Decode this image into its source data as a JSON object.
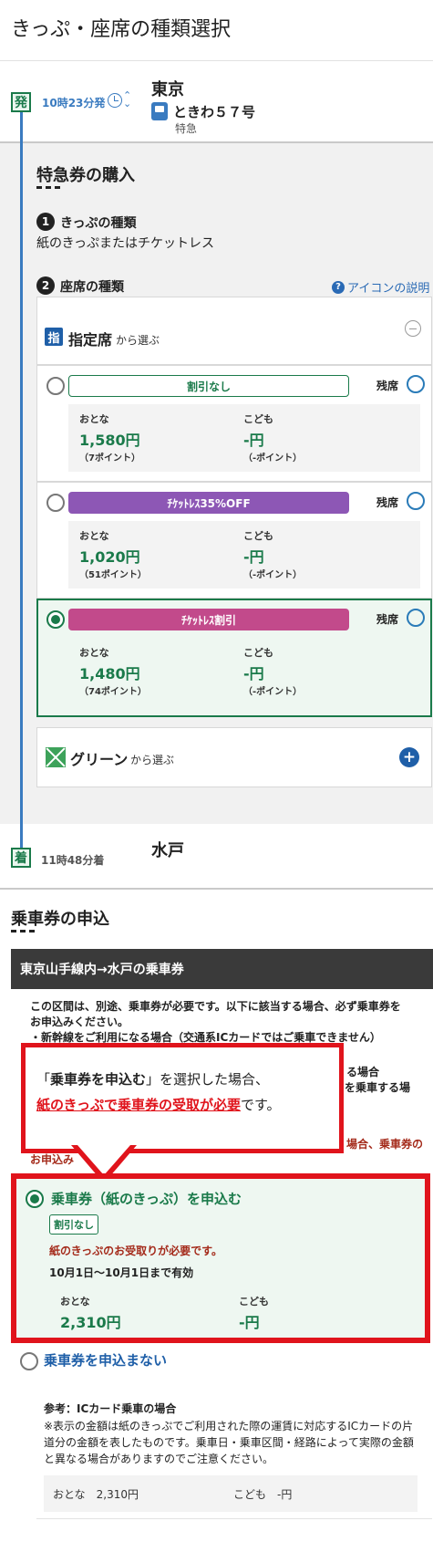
{
  "page_title": "きっぷ・座席の種類選択",
  "journey": {
    "departure": {
      "badge": "発",
      "time": "10時23分発",
      "station": "東京"
    },
    "train": {
      "name": "ときわ５７号",
      "type": "特急"
    },
    "arrival": {
      "badge": "着",
      "time": "11時48分着",
      "station": "水戸"
    }
  },
  "express_section": {
    "title": "特急券の購入",
    "step1": {
      "num": "1",
      "label": "きっぷの種類",
      "value": "紙のきっぷまたはチケットレス"
    },
    "step2": {
      "num": "2",
      "label": "座席の種類",
      "help_link": "アイコンの説明"
    },
    "reserved": {
      "badge": "指",
      "title": "指定席",
      "subtitle": "から選ぶ"
    },
    "fare_options": [
      {
        "label": "割引なし",
        "remaining": "残席",
        "adult_label": "おとな",
        "adult_price": "1,580円",
        "adult_points": "（7ポイント）",
        "child_label": "こども",
        "child_price": "-円",
        "child_points": "（-ポイント）"
      },
      {
        "label": "ﾁｹｯﾄﾚｽ35%OFF",
        "remaining": "残席",
        "adult_label": "おとな",
        "adult_price": "1,020円",
        "adult_points": "（51ポイント）",
        "child_label": "こども",
        "child_price": "-円",
        "child_points": "（-ポイント）"
      },
      {
        "label": "ﾁｹｯﾄﾚｽ割引",
        "remaining": "残席",
        "adult_label": "おとな",
        "adult_price": "1,480円",
        "adult_points": "（74ポイント）",
        "child_label": "こども",
        "child_price": "-円",
        "child_points": "（-ポイント）"
      }
    ],
    "green": {
      "title": "グリーン",
      "subtitle": "から選ぶ"
    }
  },
  "ticket_section": {
    "title": "乗車券の申込",
    "route_band": "東京山手線内→水戸の乗車券",
    "notice_line1": "この区間は、別途、乗車券が必要です。以下に該当する場合、必ず乗車券を",
    "notice_line2": "お申込みください。",
    "notice_line3": "・新幹線をご利用になる場合（交通系ICカードではご乗車できません）",
    "notice_line4": "る場合",
    "notice_line5": "を乗車する場",
    "notice_red1": "場合、乗車券の",
    "notice_red2": "お申込み",
    "callout": {
      "line1_prefix": "「",
      "line1_bold": "乗車券を申込む",
      "line1_suffix": "」を選択した場合、",
      "line2_red": "紙のきっぷで乗車券の受取が必要",
      "line2_suffix": "です。"
    },
    "apply": {
      "title": "乗車券（紙のきっぷ）を申込む",
      "tag": "割引なし",
      "warning": "紙のきっぷのお受取りが必要です。",
      "validity": "10月1日〜10月1日まで有効",
      "adult_label": "おとな",
      "adult_price": "2,310円",
      "child_label": "こども",
      "child_price": "-円"
    },
    "no_apply": "乗車券を申込まない",
    "reference": {
      "title": "参考：ICカード乗車の場合",
      "body": "※表示の金額は紙のきっぷでご利用された際の運賃に対応するICカードの片道分の金額を表したものです。乗車日・乗車区間・経路によって実際の金額と異なる場合がありますのでご注意ください。",
      "adult": "おとな　2,310円",
      "child": "こども　-円"
    }
  }
}
